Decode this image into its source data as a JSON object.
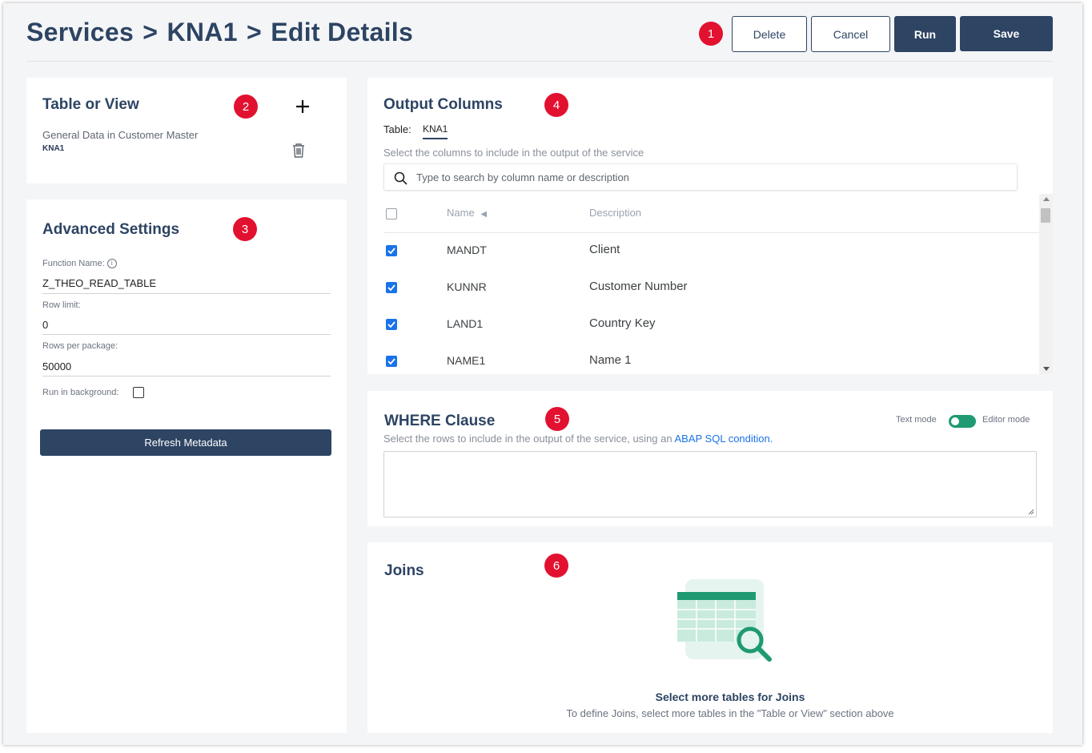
{
  "header": {
    "breadcrumb": [
      "Services",
      "KNA1",
      "Edit Details"
    ],
    "separator": ">",
    "buttons": {
      "delete": "Delete",
      "cancel": "Cancel",
      "run": "Run",
      "save": "Save"
    }
  },
  "badges": [
    "1",
    "2",
    "3",
    "4",
    "5",
    "6"
  ],
  "table_or_view": {
    "title": "Table or View",
    "add_icon": "plus-icon",
    "item_description": "General Data in Customer Master",
    "item_name": "KNA1",
    "delete_icon": "trash-icon"
  },
  "advanced_settings": {
    "title": "Advanced Settings",
    "function_name_label": "Function Name:",
    "function_name_value": "Z_THEO_READ_TABLE",
    "row_limit_label": "Row limit:",
    "row_limit_value": "0",
    "rows_per_package_label": "Rows per package:",
    "rows_per_package_value": "50000",
    "run_in_background_label": "Run in background:",
    "run_in_background_checked": false,
    "refresh_button": "Refresh Metadata"
  },
  "output_columns": {
    "title": "Output Columns",
    "table_label": "Table:",
    "table_tab": "KNA1",
    "hint": "Select the columns to include in the output of the service",
    "search_placeholder": "Type to search by column name or description",
    "headers": {
      "name": "Name",
      "description": "Description"
    },
    "rows": [
      {
        "name": "MANDT",
        "description": "Client",
        "checked": true
      },
      {
        "name": "KUNNR",
        "description": "Customer Number",
        "checked": true
      },
      {
        "name": "LAND1",
        "description": "Country Key",
        "checked": true
      },
      {
        "name": "NAME1",
        "description": "Name 1",
        "checked": true
      }
    ]
  },
  "where_clause": {
    "title": "WHERE Clause",
    "text_mode_label": "Text mode",
    "editor_mode_label": "Editor mode",
    "hint_prefix": "Select the rows to include in the output of the service, using an ",
    "hint_link": "ABAP SQL condition.",
    "textarea_value": ""
  },
  "joins": {
    "title": "Joins",
    "empty_title": "Select more tables for Joins",
    "empty_text": "To define Joins, select more tables in the \"Table or View\" section above"
  },
  "colors": {
    "primary": "#2d4463",
    "badge": "#e2112f",
    "checkbox": "#1a73e8",
    "toggle": "#1f9a72",
    "link": "#1a73e8"
  }
}
